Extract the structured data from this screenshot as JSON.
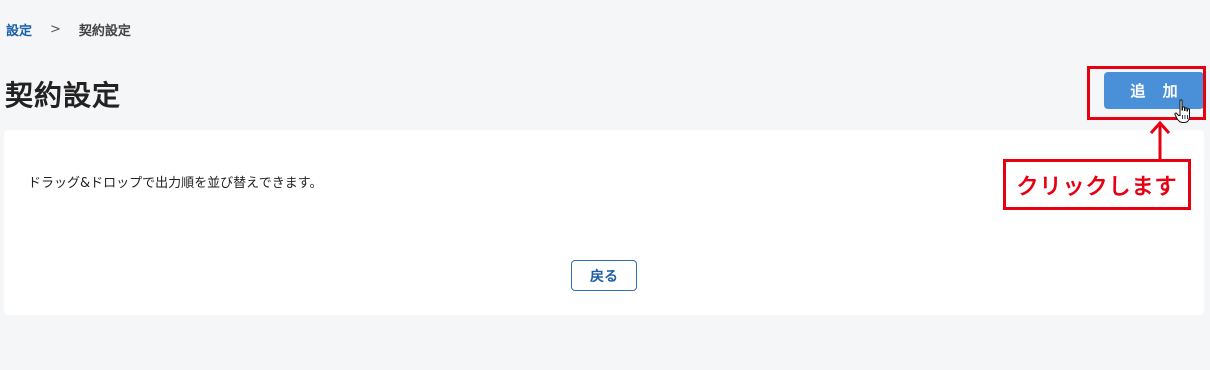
{
  "breadcrumb": {
    "parent": "設定",
    "separator": ">",
    "current": "契約設定"
  },
  "page": {
    "title": "契約設定"
  },
  "toolbar": {
    "add_label": "追 加"
  },
  "card": {
    "description": "ドラッグ&ドロップで出力順を並び替えできます。",
    "back_label": "戻る"
  },
  "annotation": {
    "callout_text": "クリックします",
    "color": "#e60012"
  },
  "colors": {
    "primary_button": "#4a90d9",
    "link": "#1a5fa8",
    "background": "#f5f6f8"
  },
  "icons": {
    "cursor": "hand-pointer-icon",
    "arrow": "arrow-up-icon"
  }
}
